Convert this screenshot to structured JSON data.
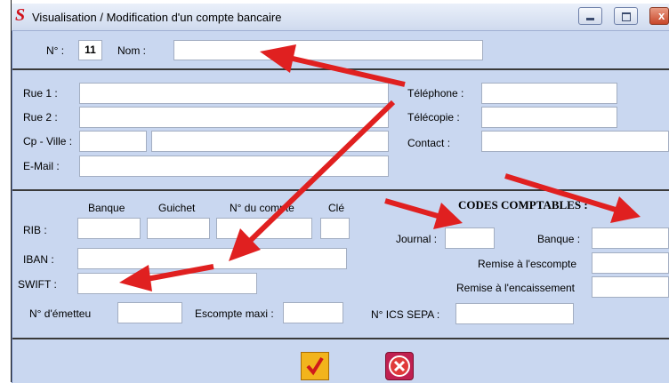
{
  "window": {
    "title": "Visualisation / Modification d'un compte bancaire",
    "logo_letter": "S"
  },
  "header": {
    "num_label": "N° :",
    "num_value": "11",
    "nom_label": "Nom :",
    "nom_value": ""
  },
  "address": {
    "rue1_label": "Rue 1 :",
    "rue2_label": "Rue 2 :",
    "cpville_label": "Cp - Ville :",
    "email_label": "E-Mail :",
    "telephone_label": "Téléphone :",
    "telecopie_label": "Télécopie :",
    "contact_label": "Contact :"
  },
  "bank": {
    "banque_col": "Banque",
    "guichet_col": "Guichet",
    "compte_col": "N° du compte",
    "cle_col": "Clé",
    "rib_label": "RIB :",
    "iban_label": "IBAN :",
    "swift_label": "SWIFT :",
    "emetteur_label": "N° d'émetteu",
    "escompte_label": "Escompte maxi :"
  },
  "codes": {
    "title": "CODES COMPTABLES :",
    "journal_label": "Journal :",
    "banque_label": "Banque :",
    "remise_escompte_label": "Remise à l'escompte",
    "remise_encaissement_label": "Remise à l'encaissement",
    "ics_label": "N° ICS SEPA :"
  },
  "actions": {
    "validate_icon": "checkmark-icon",
    "cancel_icon": "cancel-x-icon"
  },
  "colors": {
    "window_bg": "#c9d7f0",
    "arrow": "#e02020",
    "validate_bg": "#f2b41c",
    "cancel_bg": "#c02050"
  }
}
